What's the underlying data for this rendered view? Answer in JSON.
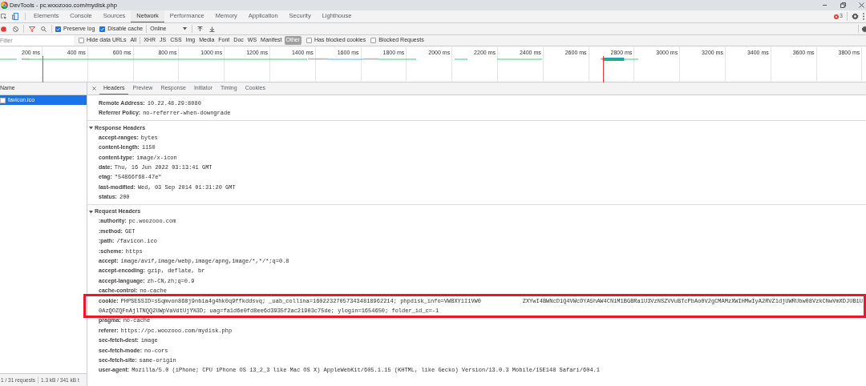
{
  "window": {
    "title": "DevTools - pc.woozooo.com/mydisk.php"
  },
  "tabs": [
    {
      "label": "Elements",
      "selected": false
    },
    {
      "label": "Console",
      "selected": false
    },
    {
      "label": "Sources",
      "selected": false
    },
    {
      "label": "Network",
      "selected": true
    },
    {
      "label": "Performance",
      "selected": false
    },
    {
      "label": "Memory",
      "selected": false
    },
    {
      "label": "Application",
      "selected": false
    },
    {
      "label": "Security",
      "selected": false
    },
    {
      "label": "Lighthouse",
      "selected": false
    }
  ],
  "error_count": "3",
  "toolbar": {
    "recording": true,
    "filter_active": true,
    "checkboxes": [
      {
        "label": "Preserve log",
        "checked": true
      },
      {
        "label": "Disable cache",
        "checked": true
      }
    ],
    "throttling": "Online"
  },
  "filter_bar": {
    "placeholder": "Filter",
    "hide_data_urls": {
      "label": "Hide data URLs",
      "checked": false
    },
    "types": [
      {
        "label": "All",
        "selected": false
      },
      {
        "label": "XHR",
        "selected": false
      },
      {
        "label": "JS",
        "selected": false
      },
      {
        "label": "CSS",
        "selected": false
      },
      {
        "label": "Img",
        "selected": false
      },
      {
        "label": "Media",
        "selected": false
      },
      {
        "label": "Font",
        "selected": false
      },
      {
        "label": "Doc",
        "selected": false
      },
      {
        "label": "WS",
        "selected": false
      },
      {
        "label": "Manifest",
        "selected": false
      },
      {
        "label": "Other",
        "selected": true
      }
    ],
    "extra_checkboxes": [
      {
        "label": "Has blocked cookies",
        "checked": false
      },
      {
        "label": "Blocked Requests",
        "checked": false
      }
    ]
  },
  "timeline": {
    "ticks": [
      "200 ms",
      "400 ms",
      "600 ms",
      "800 ms",
      "1000 ms",
      "1200 ms",
      "1400 ms",
      "1600 ms",
      "1800 ms",
      "2000 ms",
      "2200 ms",
      "2400 ms",
      "2600 ms",
      "2800 ms",
      "3000 ms",
      "3200 ms",
      "3400 ms",
      "3600 ms",
      "3800 ms"
    ]
  },
  "requests": {
    "column": "Name",
    "rows": [
      {
        "name": "favicon.ico",
        "selected": true
      }
    ],
    "status": [
      "1 / 31 requests",
      "1.3 kB / 341 kB t"
    ]
  },
  "detail_tabs": [
    {
      "label": "Headers",
      "selected": true
    },
    {
      "label": "Preview",
      "selected": false
    },
    {
      "label": "Response",
      "selected": false
    },
    {
      "label": "Initiator",
      "selected": false
    },
    {
      "label": "Timing",
      "selected": false
    },
    {
      "label": "Cookies",
      "selected": false
    }
  ],
  "general": [
    {
      "name": "Remote Address:",
      "value": "10.22.48.29:8080"
    },
    {
      "name": "Referrer Policy:",
      "value": "no-referrer-when-downgrade"
    }
  ],
  "response_headers": {
    "title": "Response Headers",
    "expanded": true,
    "rows": [
      {
        "name": "accept-ranges:",
        "value": "bytes"
      },
      {
        "name": "content-length:",
        "value": "1150"
      },
      {
        "name": "content-type:",
        "value": "image/x-icon"
      },
      {
        "name": "date:",
        "value": "Thu, 16 Jun 2022 03:13:41 GMT"
      },
      {
        "name": "etag:",
        "value": "\"54866f68-47e\""
      },
      {
        "name": "last-modified:",
        "value": "Wed, 03 Sep 2014 01:31:20 GMT"
      },
      {
        "name": "status:",
        "value": "200"
      }
    ]
  },
  "request_headers": {
    "title": "Request Headers",
    "expanded": true,
    "rows": [
      {
        "name": ":authority:",
        "value_lines": [
          [
            "pc.woozooo.com"
          ]
        ],
        "highlighted": false
      },
      {
        "name": ":method:",
        "value_lines": [
          [
            "GET"
          ]
        ],
        "highlighted": false
      },
      {
        "name": ":path:",
        "value_lines": [
          [
            "/favicon.ico"
          ]
        ],
        "highlighted": false
      },
      {
        "name": ":scheme:",
        "value_lines": [
          [
            "https"
          ]
        ],
        "highlighted": false
      },
      {
        "name": "accept:",
        "value_lines": [
          [
            "image/avif,image/webp,image/apng,image/*,*/*;q=0.8"
          ]
        ],
        "highlighted": false
      },
      {
        "name": "accept-encoding:",
        "value_lines": [
          [
            "gzip, deflate, br"
          ]
        ],
        "highlighted": false
      },
      {
        "name": "accept-language:",
        "value_lines": [
          [
            "zh-CN,zh;q=0.9"
          ]
        ],
        "highlighted": false
      },
      {
        "name": "cache-control:",
        "value_lines": [
          [
            "no-cache"
          ]
        ],
        "highlighted": false
      },
      {
        "name": "cookie:",
        "value_lines": [
          [
            "PHPSESSID=s5qmvon868j9nbia4g4hk0q9ffkddsvq; _uab_collina=160223270573434818962214; phpdisk_info=VWBXY1I1VW0",
            "ZXYwI4BWNcD1Q4VWcDYA5hAW4CN1M1BGBRa1U3VzNSZVVuBTcPbAo0V2gCMAMzXWIHMwIyA2RVZ1djUWRUbw08VzkCNwVmXDJUB1U"
          ],
          [
            "0AzQOZQFnAjlTNQQ2UWpVaVdtUjY%3D; uag=fa1d6e0fd8ee6d3935f2ac21903c75de; ylogin=1654650; folder_id_c=-1"
          ]
        ],
        "highlighted": true
      },
      {
        "name": "pragma:",
        "value_lines": [
          [
            "no-cache"
          ]
        ],
        "highlighted": false
      },
      {
        "name": "referer:",
        "value_lines": [
          [
            "https://pc.woozooo.com/mydisk.php"
          ]
        ],
        "highlighted": false
      },
      {
        "name": "sec-fetch-dest:",
        "value_lines": [
          [
            "image"
          ]
        ],
        "highlighted": false
      },
      {
        "name": "sec-fetch-mode:",
        "value_lines": [
          [
            "no-cors"
          ]
        ],
        "highlighted": false
      },
      {
        "name": "sec-fetch-site:",
        "value_lines": [
          [
            "same-origin"
          ]
        ],
        "highlighted": false
      },
      {
        "name": "user-agent:",
        "value_lines": [
          [
            "Mozilla/5.0 (iPhone; CPU iPhone OS 13_2_3 like Mac OS X) AppleWebKit/605.1.15 (KHTML, like Gecko) Version/13.0.3 Mobile/15E148 Safari/604.1"
          ]
        ],
        "highlighted": false
      }
    ]
  }
}
